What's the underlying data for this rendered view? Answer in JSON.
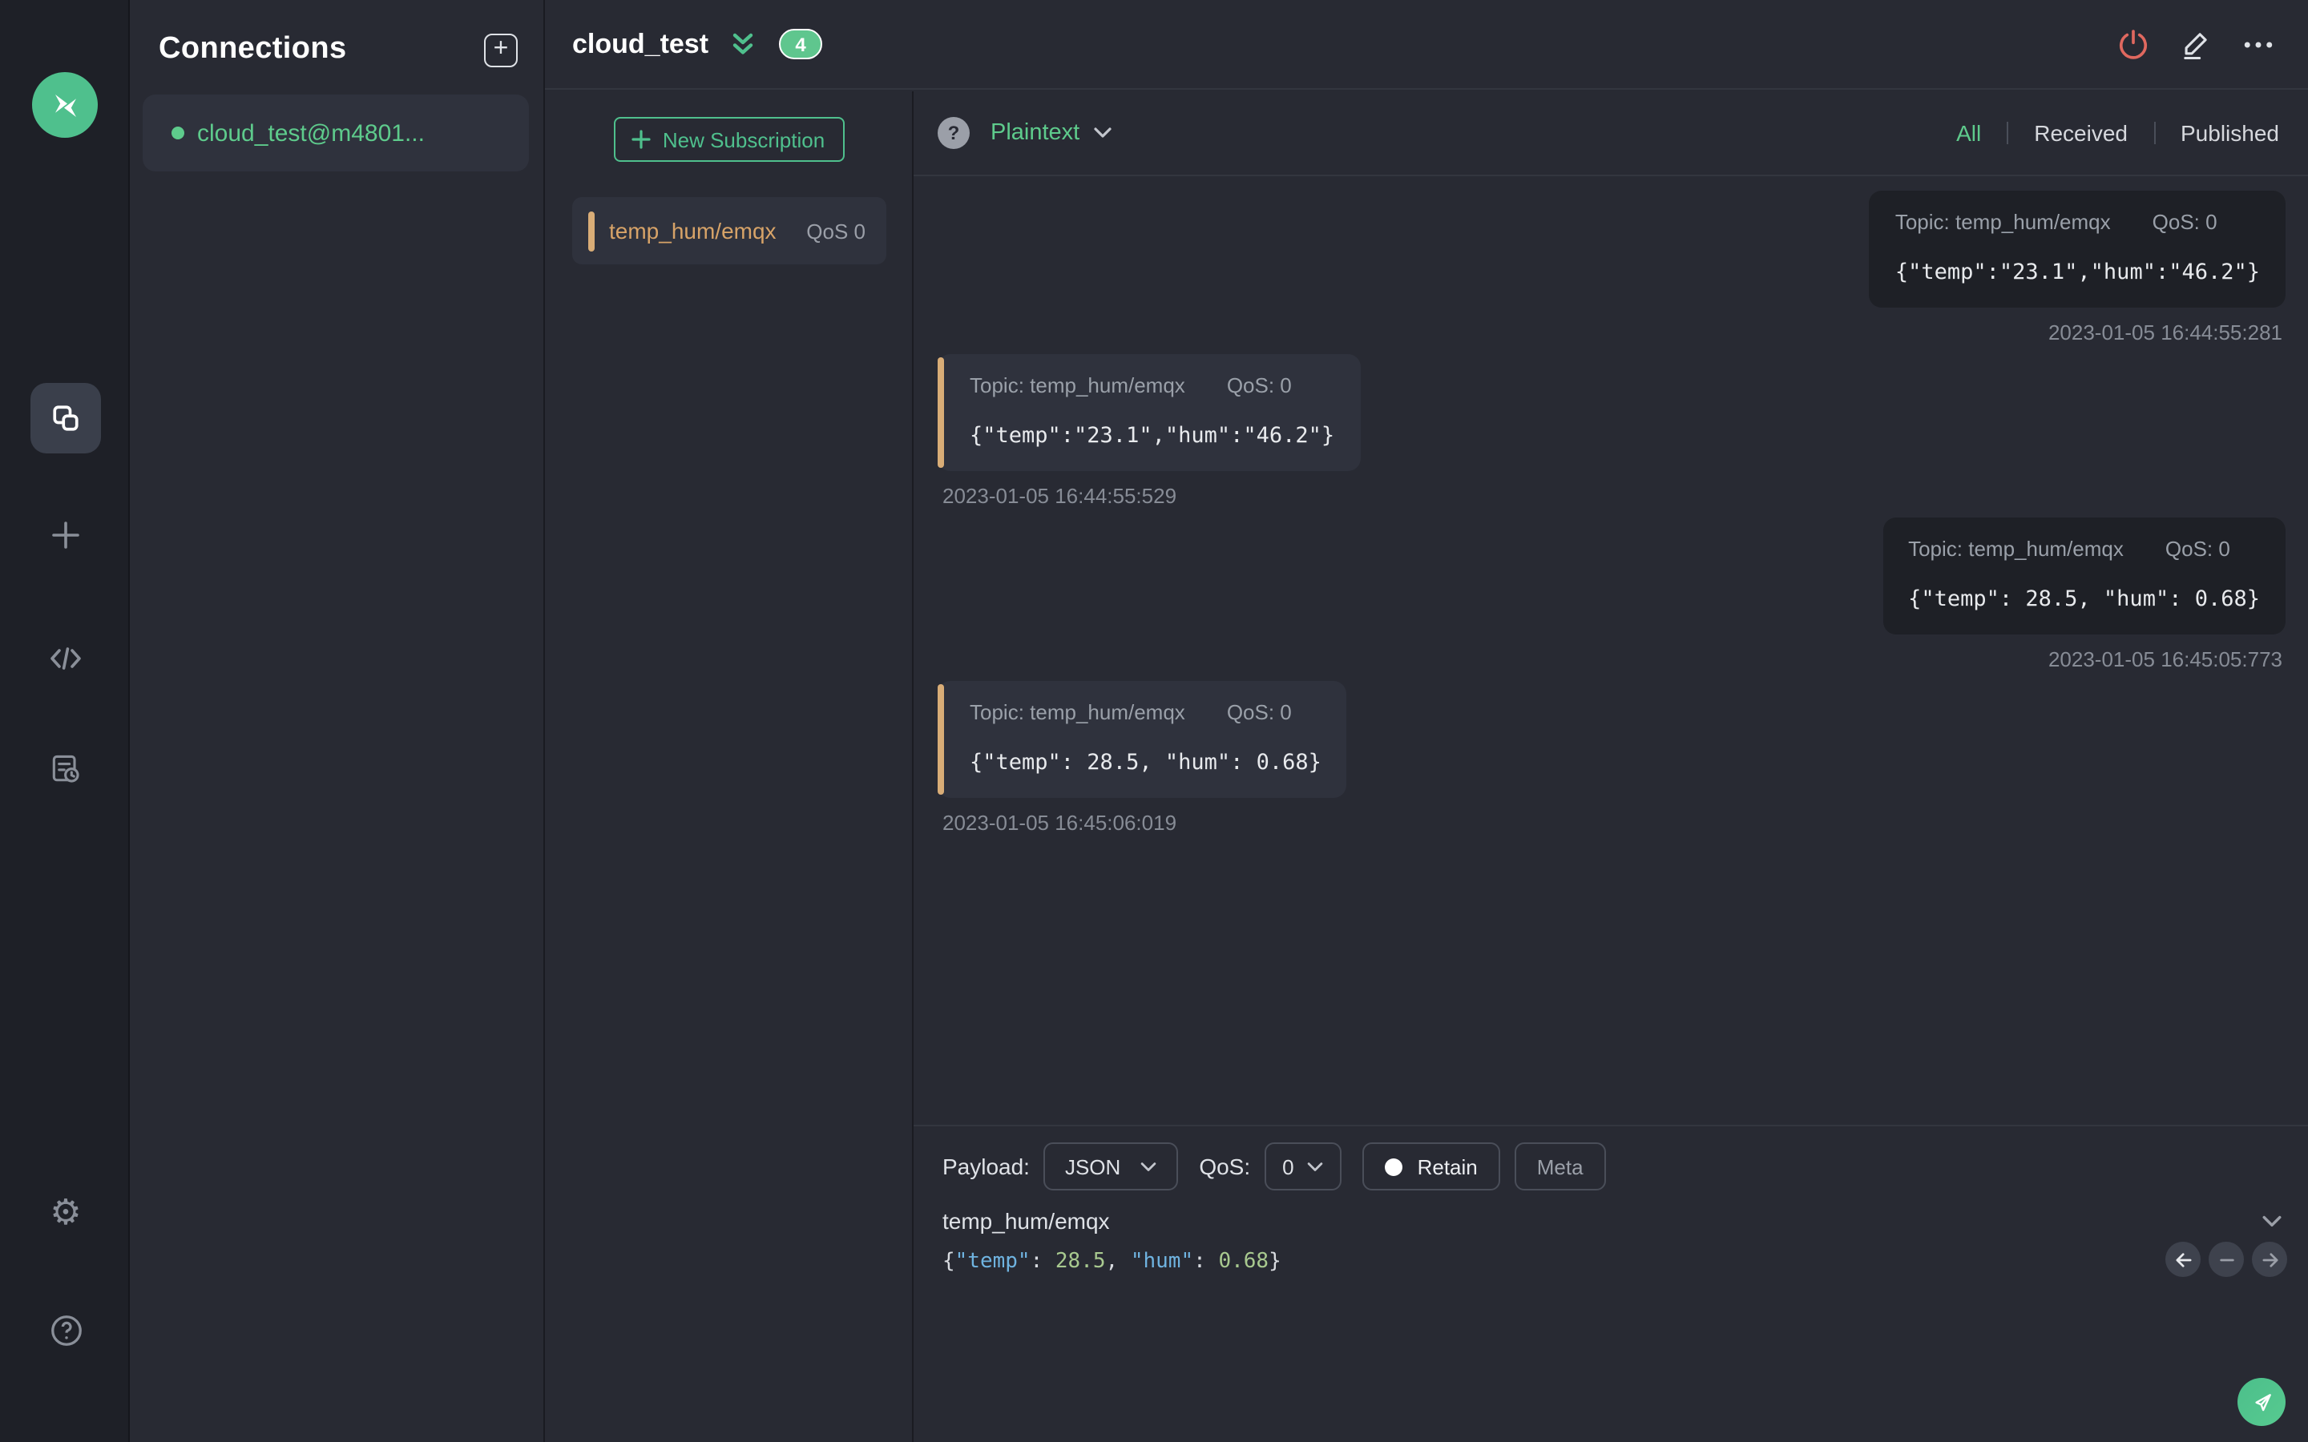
{
  "colors": {
    "accent_green": "#4fc08d",
    "green_text": "#5ecb8c",
    "tan_accent": "#d9ad77",
    "power_red": "#e0685f",
    "panel_bg": "#282a33",
    "received_bubble": "#2f323d",
    "published_bubble": "#1e2026"
  },
  "sidebar": {
    "icons": [
      {
        "name": "mqttx-logo"
      },
      {
        "name": "connections-icon",
        "active": true
      },
      {
        "name": "new-connection-plus-icon"
      },
      {
        "name": "script-code-icon"
      },
      {
        "name": "log-icon"
      },
      {
        "name": "settings-gear-icon"
      },
      {
        "name": "help-icon"
      }
    ]
  },
  "connections": {
    "title": "Connections",
    "items": [
      {
        "name": "cloud_test@m4801...",
        "status": "connected"
      }
    ]
  },
  "topbar": {
    "title": "cloud_test",
    "badge_count": "4"
  },
  "subscriptions": {
    "new_button_label": "New Subscription",
    "items": [
      {
        "topic": "temp_hum/emqx",
        "qos_label": "QoS 0"
      }
    ]
  },
  "messages": {
    "format_label": "Plaintext",
    "help_glyph": "?",
    "tabs": [
      {
        "label": "All",
        "active": true
      },
      {
        "label": "Received",
        "active": false
      },
      {
        "label": "Published",
        "active": false
      }
    ],
    "items": [
      {
        "side": "right",
        "topic_label": "Topic: temp_hum/emqx",
        "qos_label": "QoS: 0",
        "payload": "{\"temp\":\"23.1\",\"hum\":\"46.2\"}",
        "timestamp": "2023-01-05 16:44:55:281"
      },
      {
        "side": "left",
        "topic_label": "Topic: temp_hum/emqx",
        "qos_label": "QoS: 0",
        "payload": "{\"temp\":\"23.1\",\"hum\":\"46.2\"}",
        "timestamp": "2023-01-05 16:44:55:529"
      },
      {
        "side": "right",
        "topic_label": "Topic: temp_hum/emqx",
        "qos_label": "QoS: 0",
        "payload": "{\"temp\": 28.5, \"hum\": 0.68}",
        "timestamp": "2023-01-05 16:45:05:773"
      },
      {
        "side": "left",
        "topic_label": "Topic: temp_hum/emqx",
        "qos_label": "QoS: 0",
        "payload": "{\"temp\": 28.5, \"hum\": 0.68}",
        "timestamp": "2023-01-05 16:45:06:019"
      }
    ]
  },
  "publish": {
    "payload_label": "Payload:",
    "payload_type": "JSON",
    "qos_label": "QoS:",
    "qos_value": "0",
    "retain_label": "Retain",
    "meta_label": "Meta",
    "topic_value": "temp_hum/emqx",
    "editor_tokens": [
      {
        "text": "{",
        "type": "punct"
      },
      {
        "text": "\"temp\"",
        "type": "key"
      },
      {
        "text": ": ",
        "type": "punct"
      },
      {
        "text": "28.5",
        "type": "num"
      },
      {
        "text": ", ",
        "type": "punct"
      },
      {
        "text": "\"hum\"",
        "type": "key"
      },
      {
        "text": ": ",
        "type": "punct"
      },
      {
        "text": "0.68",
        "type": "num"
      },
      {
        "text": "}",
        "type": "punct"
      }
    ]
  }
}
